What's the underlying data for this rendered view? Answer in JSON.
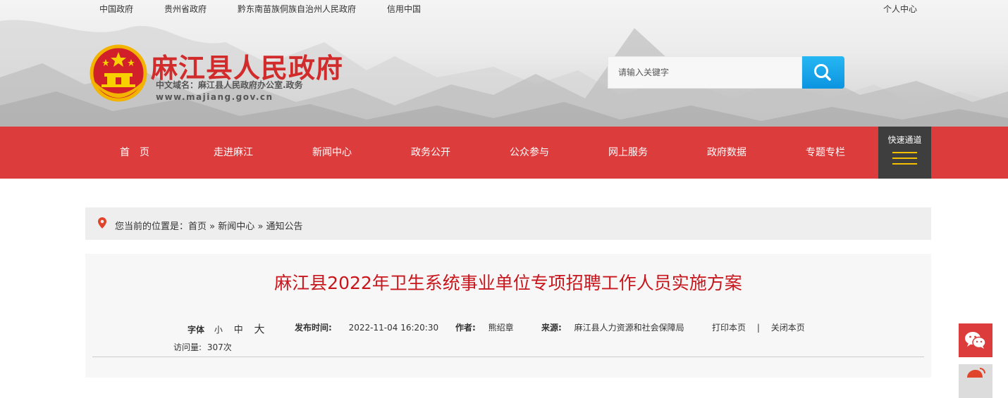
{
  "toplinks": [
    "中国政府",
    "贵州省政府",
    "黔东南苗族侗族自治州人民政府",
    "信用中国"
  ],
  "user_center": "个人中心",
  "site": {
    "title": "麻江县人民政府",
    "domain_line": "中文域名：麻江县人民政府办公室.政务",
    "url": "www.majiang.gov.cn"
  },
  "search": {
    "placeholder": "请输入关键字"
  },
  "nav": {
    "items": [
      "首　页",
      "走进麻江",
      "新闻中心",
      "政务公开",
      "公众参与",
      "网上服务",
      "政府数据",
      "专题专栏"
    ],
    "quick_label": "快速通道"
  },
  "breadcrumb": {
    "prefix": "您当前的位置是：",
    "items": [
      "首页",
      "新闻中心",
      "通知公告"
    ],
    "separator": "»"
  },
  "article": {
    "title": "麻江县2022年卫生系统事业单位专项招聘工作人员实施方案",
    "font_label": "字体",
    "font_sizes": [
      "小",
      "中",
      "大"
    ],
    "published_label": "发布时间:",
    "published": "2022-11-04 16:20:30",
    "author_label": "作者:",
    "author": "熊绍章",
    "source_label": "来源:",
    "source": "麻江县人力资源和社会保障局",
    "print": "打印本页",
    "divider": "|",
    "close": "关闭本页",
    "visits_label": "访问量:",
    "visits": "307次"
  },
  "colors": {
    "brand_red": "#dd3c3c",
    "title_red": "#c8161d",
    "search_blue": "#0b94e0",
    "quick_dark": "#3e3e3e",
    "gold": "#f5c000"
  },
  "icons": [
    "search-icon",
    "menu-icon",
    "location-pin-icon",
    "wechat-icon",
    "weibo-icon",
    "national-emblem"
  ]
}
